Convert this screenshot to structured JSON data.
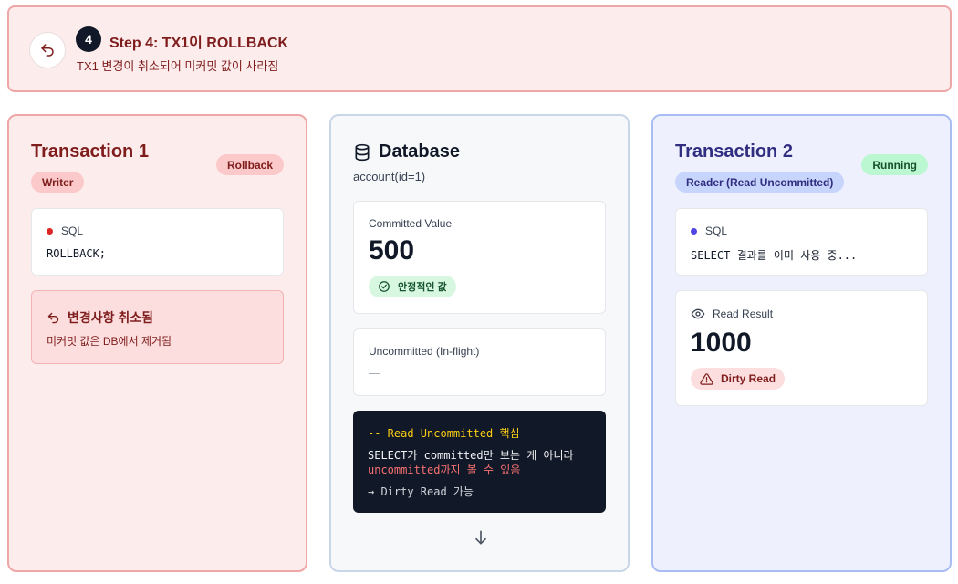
{
  "header": {
    "step_number": "4",
    "title": "Step 4: TX1이 ROLLBACK",
    "subtitle": "TX1 변경이 취소되어 미커밋 값이 사라짐"
  },
  "tx1": {
    "title": "Transaction 1",
    "status": "Rollback",
    "role": "Writer",
    "sql_label": "SQL",
    "sql_text": "ROLLBACK;",
    "notice_title": "변경사항 취소됨",
    "notice_text": "미커밋 값은 DB에서 제거됨"
  },
  "database": {
    "title": "Database",
    "subtitle": "account(id=1)",
    "committed_label": "Committed Value",
    "committed_value": "500",
    "committed_badge": "안정적인 값",
    "uncommitted_label": "Uncommitted (In-flight)",
    "uncommitted_value": "—",
    "code": {
      "comment": "-- Read Uncommitted 핵심",
      "line1": "SELECT가 committed만 보는 게 아니라",
      "line2": "uncommitted까지 볼 수 있음",
      "line3": "→ Dirty Read 가능"
    }
  },
  "tx2": {
    "title": "Transaction 2",
    "status": "Running",
    "role": "Reader (Read Uncommitted)",
    "sql_label": "SQL",
    "sql_text": "SELECT 결과를 이미 사용 중...",
    "read_label": "Read Result",
    "read_value": "1000",
    "read_badge": "Dirty Read"
  },
  "colors": {
    "tx1_accent": "#7f1d1d",
    "tx2_accent": "#312e81",
    "tx1_dot": "#dc2626",
    "tx2_dot": "#4f46e5",
    "success": "#14532d"
  }
}
